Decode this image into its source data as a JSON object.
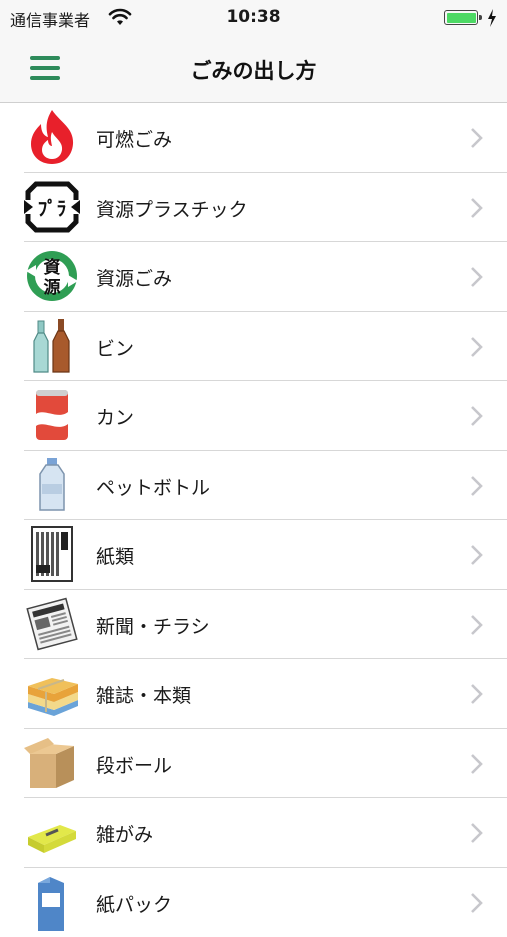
{
  "status_bar": {
    "carrier": "通信事業者",
    "time": "10:38",
    "wifi_icon": "wifi-icon",
    "battery_level": 1.0,
    "charging_icon": "bolt-icon"
  },
  "navbar": {
    "title": "ごみの出し方",
    "menu_icon": "hamburger-menu-icon",
    "accent_color": "#2e8b5b"
  },
  "categories": [
    {
      "label": "可燃ごみ",
      "icon": "flame-icon"
    },
    {
      "label": "資源プラスチック",
      "icon": "plastic-recycle-icon"
    },
    {
      "label": "資源ごみ",
      "icon": "resource-recycle-icon"
    },
    {
      "label": "ビン",
      "icon": "bottles-icon"
    },
    {
      "label": "カン",
      "icon": "can-icon"
    },
    {
      "label": "ペットボトル",
      "icon": "pet-bottle-icon"
    },
    {
      "label": "紙類",
      "icon": "paper-icon"
    },
    {
      "label": "新聞・チラシ",
      "icon": "newspaper-icon"
    },
    {
      "label": "雑誌・本類",
      "icon": "books-icon"
    },
    {
      "label": "段ボール",
      "icon": "cardboard-box-icon"
    },
    {
      "label": "雑がみ",
      "icon": "misc-paper-icon"
    },
    {
      "label": "紙パック",
      "icon": "milk-carton-icon"
    }
  ]
}
